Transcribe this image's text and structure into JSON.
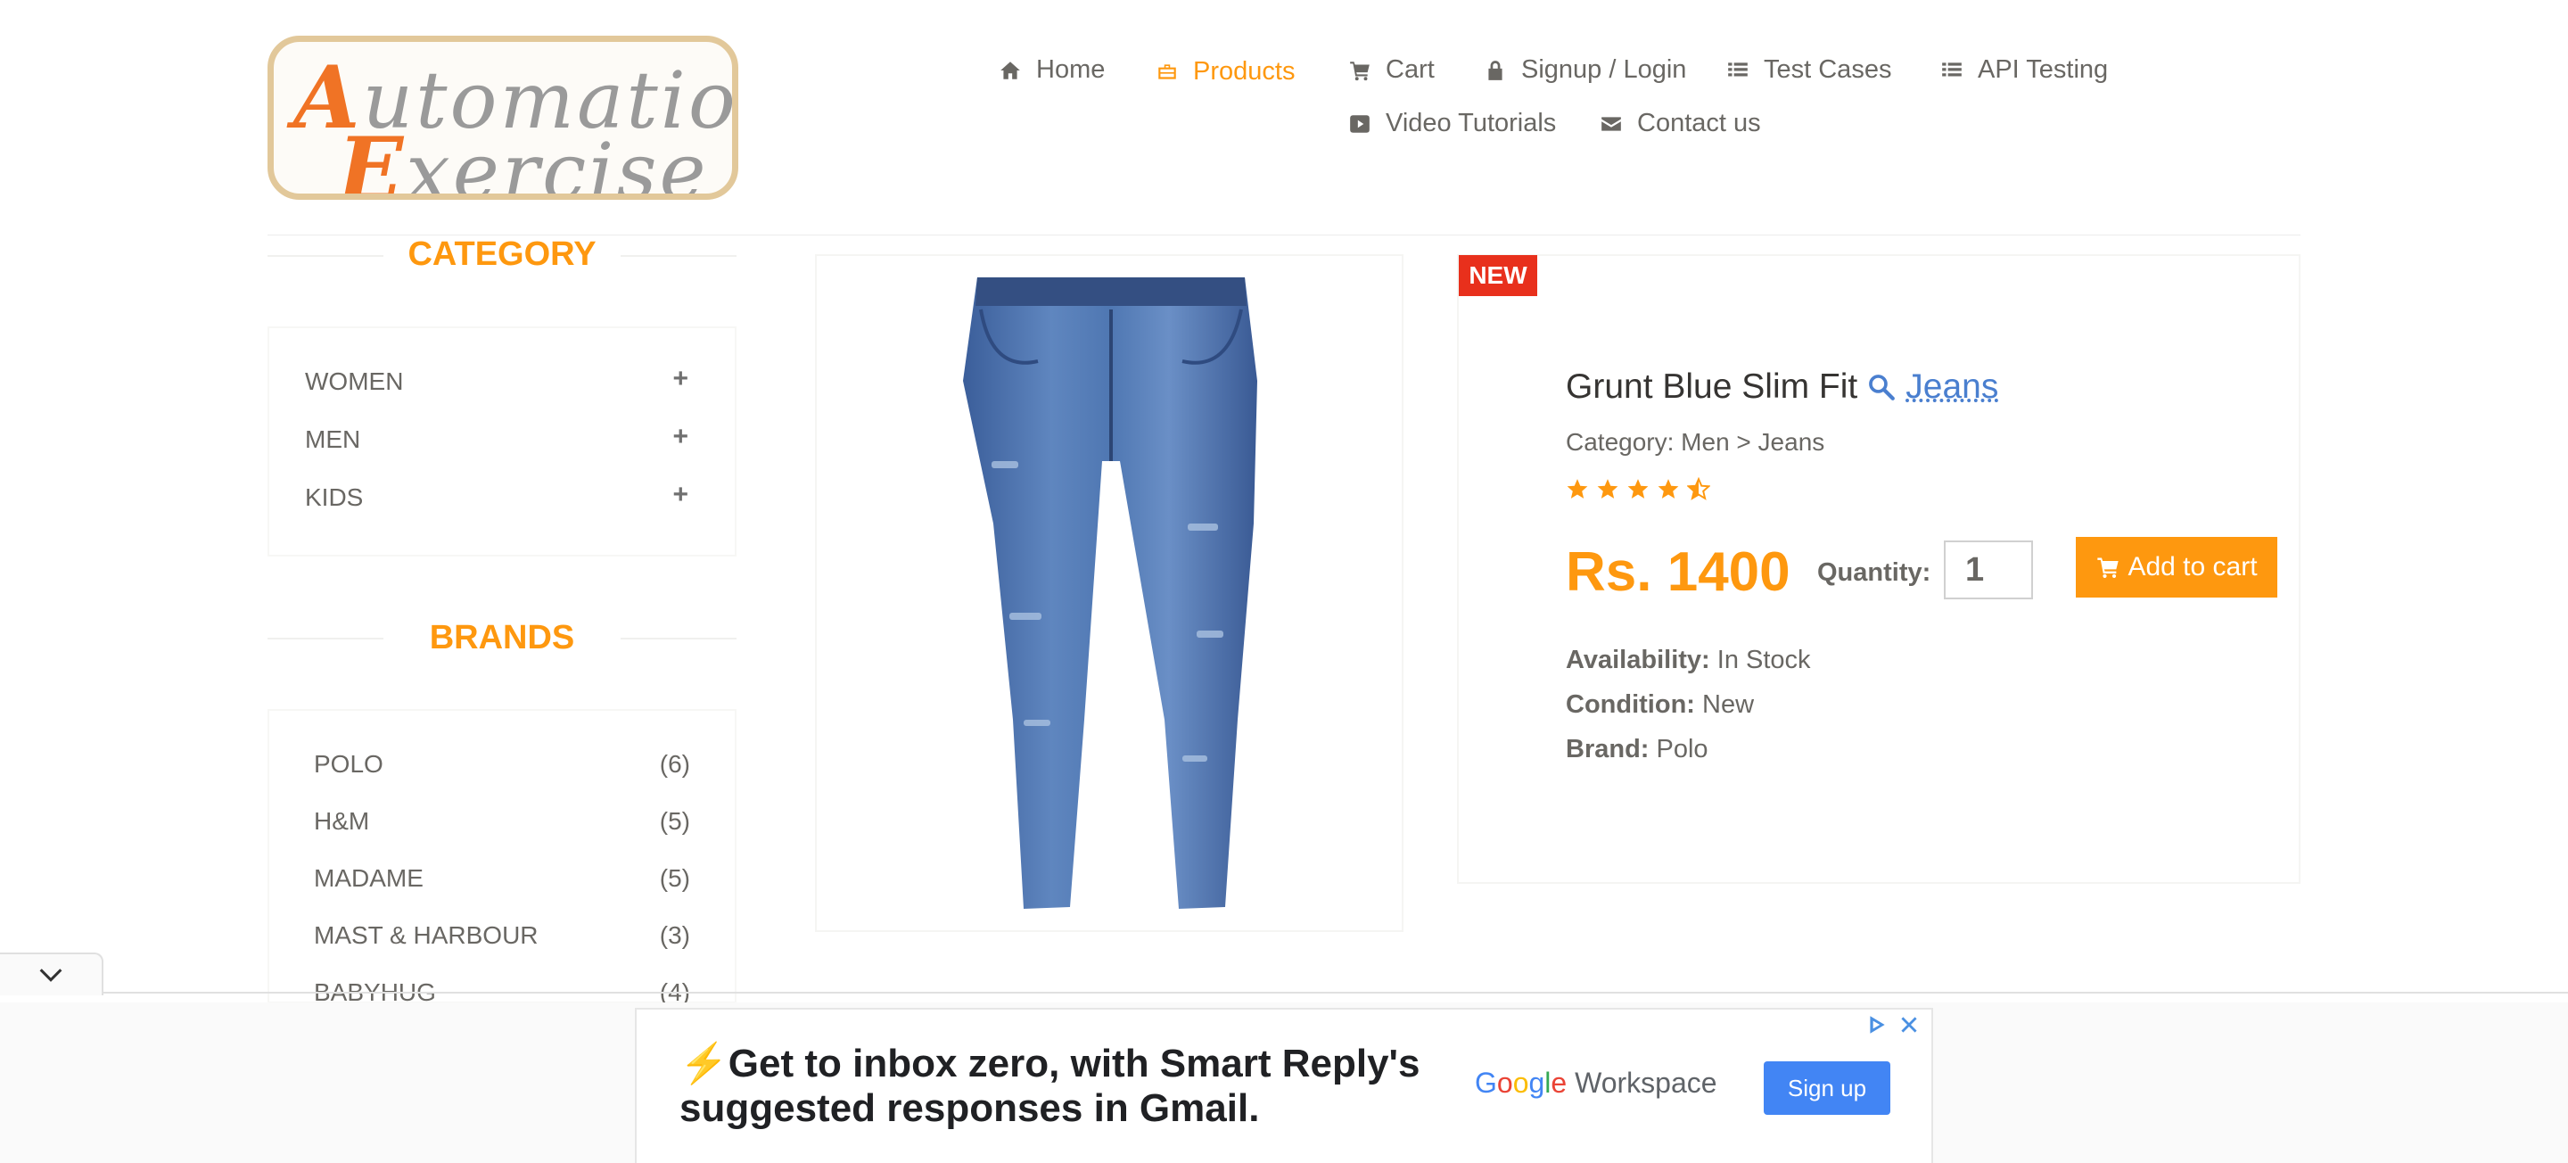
{
  "logo": {
    "line1": "Automation",
    "line2": "Exercise"
  },
  "nav": {
    "home": "Home",
    "products": "Products",
    "cart": "Cart",
    "login": "Signup / Login",
    "test_cases": "Test Cases",
    "api_testing": "API Testing",
    "video_tutorials": "Video Tutorials",
    "contact": "Contact us"
  },
  "sidebar": {
    "category_title": "CATEGORY",
    "categories": [
      {
        "label": "WOMEN",
        "icon": "plus-icon"
      },
      {
        "label": "MEN",
        "icon": "plus-icon"
      },
      {
        "label": "KIDS",
        "icon": "plus-icon"
      }
    ],
    "brands_title": "BRANDS",
    "brands": [
      {
        "label": "POLO",
        "count": "(6)"
      },
      {
        "label": "H&M",
        "count": "(5)"
      },
      {
        "label": "MADAME",
        "count": "(5)"
      },
      {
        "label": "MAST & HARBOUR",
        "count": "(3)"
      },
      {
        "label": "BABYHUG",
        "count": "(4)"
      }
    ]
  },
  "product": {
    "badge": "NEW",
    "title_text": "Grunt Blue Slim Fit",
    "title_link": "Jeans",
    "category": "Category: Men > Jeans",
    "rating_stars": 4.5,
    "price": "Rs. 1400",
    "quantity_label": "Quantity:",
    "quantity_value": "1",
    "add_to_cart": "Add to cart",
    "availability_label": "Availability:",
    "availability_value": "In Stock",
    "condition_label": "Condition:",
    "condition_value": "New",
    "brand_label": "Brand:",
    "brand_value": "Polo"
  },
  "ad": {
    "headline": "Get to inbox zero, with Smart Reply's suggested responses in Gmail.",
    "brand_word": "Workspace",
    "cta": "Sign up"
  },
  "colors": {
    "accent": "#fe980f",
    "badge": "#e8301c",
    "link": "#4a7fcf",
    "ad_button": "#4285f4"
  }
}
